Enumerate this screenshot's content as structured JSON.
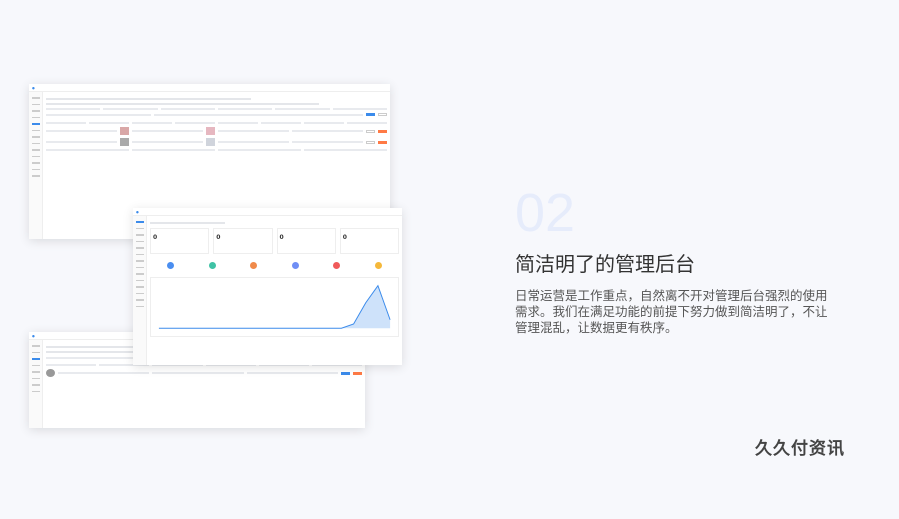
{
  "section": {
    "number": "02",
    "title": "简洁明了的管理后台",
    "description": "日常运营是工作重点，自然离不开对管理后台强烈的使用需求。我们在满足功能的前提下努力做到简洁明了，不让管理混乱，让数据更有秩序。"
  },
  "brand": "久久付资讯",
  "screens": {
    "dashboard": {
      "stat_values": [
        "0",
        "0",
        "0",
        "0"
      ]
    }
  },
  "chart_data": {
    "type": "area",
    "x": [
      1,
      2,
      3,
      4,
      5,
      6,
      7,
      8,
      9,
      10,
      11,
      12,
      13,
      14,
      15,
      16,
      17,
      18,
      19,
      20
    ],
    "series": [
      {
        "values": [
          0,
          0,
          0,
          0,
          0,
          0,
          0,
          0,
          0,
          0,
          0,
          0,
          0,
          0,
          0,
          0,
          0.1,
          0.6,
          1.0,
          0.2
        ]
      }
    ],
    "color": "#3b8beb"
  }
}
